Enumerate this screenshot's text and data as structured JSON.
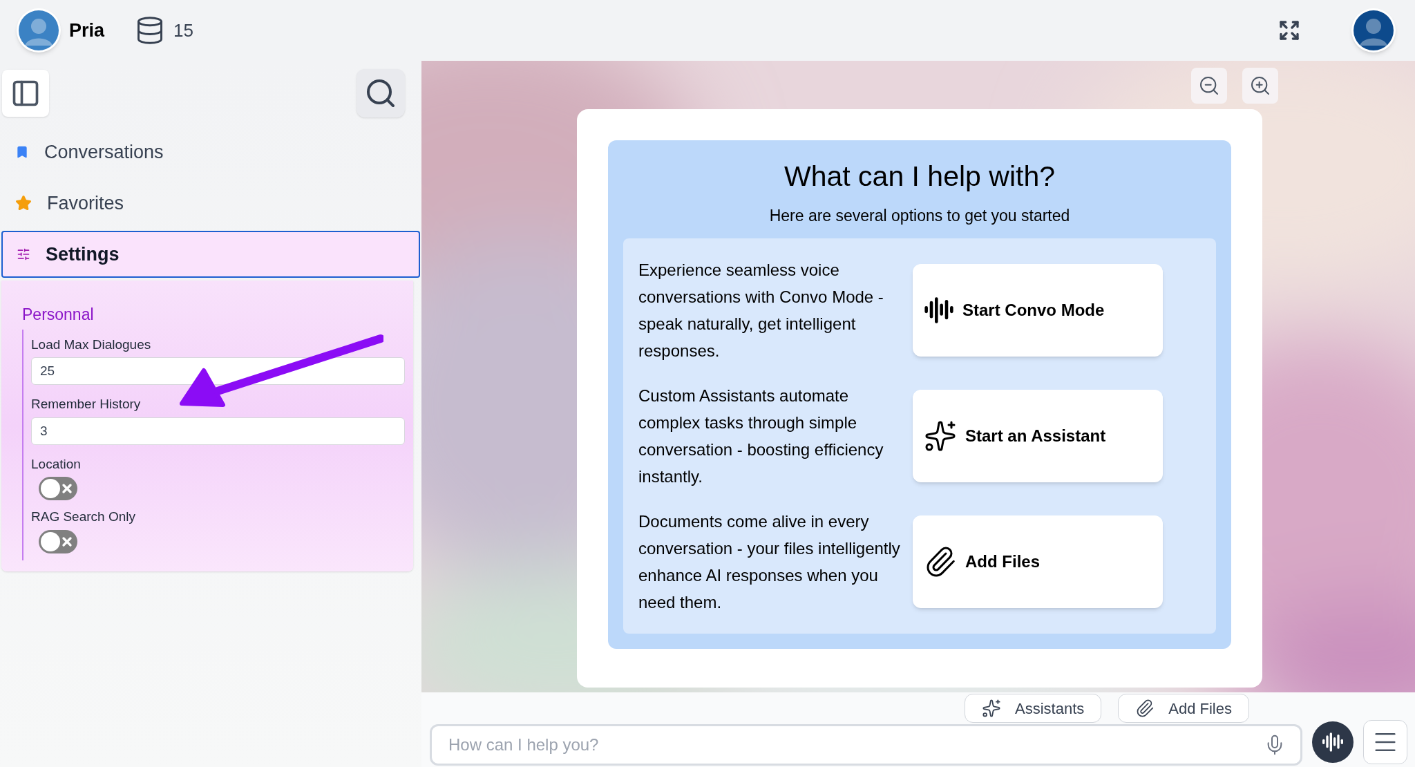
{
  "header": {
    "user_name": "Pria",
    "credit_count": "15"
  },
  "sidebar": {
    "items": [
      {
        "label": "Conversations",
        "selected": false
      },
      {
        "label": "Favorites",
        "selected": false
      },
      {
        "label": "Settings",
        "selected": true
      }
    ],
    "settings_panel": {
      "section": "Personnal",
      "fields": [
        {
          "kind": "input",
          "label": "Load Max Dialogues",
          "value": "25"
        },
        {
          "kind": "input",
          "label": "Remember History",
          "value": "3"
        },
        {
          "kind": "toggle",
          "label": "Location",
          "on": false
        },
        {
          "kind": "toggle",
          "label": "RAG Search Only",
          "on": false
        }
      ]
    }
  },
  "welcome": {
    "title": "What can I help with?",
    "subtitle": "Here are several options to get you started",
    "options": [
      {
        "description": "Experience seamless voice conversations with Convo Mode - speak naturally, get intelligent responses.",
        "button": "Start Convo Mode"
      },
      {
        "description": "Custom Assistants automate complex tasks through simple conversation - boosting efficiency instantly.",
        "button": "Start an Assistant"
      },
      {
        "description": "Documents come alive in every conversation - your files intelligently enhance AI responses when you need them.",
        "button": "Add Files"
      }
    ]
  },
  "composer": {
    "chips": [
      "Assistants",
      "Add Files"
    ],
    "placeholder": "How can I help you?"
  }
}
